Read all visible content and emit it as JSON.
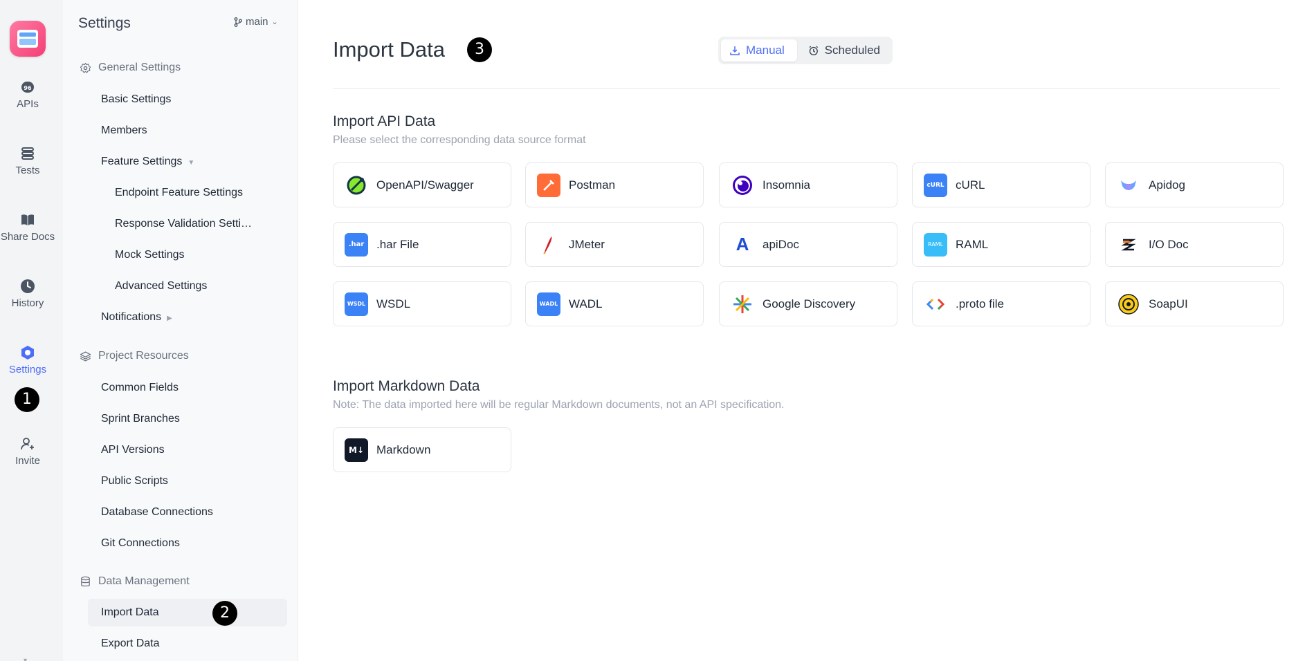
{
  "rail": {
    "items": [
      {
        "label": "APIs",
        "icon": "api-icon"
      },
      {
        "label": "Tests",
        "icon": "tests-icon"
      },
      {
        "label": "Share Docs",
        "icon": "book-icon"
      },
      {
        "label": "History",
        "icon": "clock-icon"
      },
      {
        "label": "Settings",
        "icon": "settings-icon"
      },
      {
        "label": "Invite",
        "icon": "user-plus-icon"
      }
    ],
    "active": "Settings"
  },
  "panel": {
    "title": "Settings",
    "branch": "main",
    "groups": {
      "general": "General Settings",
      "resources": "Project Resources",
      "data": "Data Management"
    },
    "items": {
      "basic": "Basic Settings",
      "members": "Members",
      "feature": "Feature Settings",
      "endpoint": "Endpoint Feature Settings",
      "response": "Response Validation Setti…",
      "mock": "Mock Settings",
      "advanced": "Advanced Settings",
      "notifications": "Notifications",
      "common_fields": "Common Fields",
      "sprint": "Sprint Branches",
      "api_versions": "API Versions",
      "public_scripts": "Public Scripts",
      "db": "Database Connections",
      "git": "Git Connections",
      "import": "Import Data",
      "export": "Export Data"
    }
  },
  "annotations": {
    "one": "1",
    "two": "2",
    "three": "3"
  },
  "main": {
    "title": "Import Data",
    "tabs": {
      "manual": "Manual",
      "scheduled": "Scheduled",
      "active": "Manual"
    },
    "api_section": {
      "title": "Import API Data",
      "subtitle": "Please select the corresponding data source format",
      "cards": [
        {
          "name": "OpenAPI/Swagger",
          "icon": "swagger-icon",
          "color": "#85ea2d"
        },
        {
          "name": "Postman",
          "icon": "postman-icon",
          "color": "#ff6c37"
        },
        {
          "name": "Insomnia",
          "icon": "insomnia-icon",
          "color": "#4000bf"
        },
        {
          "name": "cURL",
          "icon": "curl-icon",
          "color": "#3b82f6"
        },
        {
          "name": "Apidog",
          "icon": "apidog-icon",
          "color": "#8b5cf6"
        },
        {
          "name": ".har File",
          "icon": "har-icon",
          "color": "#3b82f6"
        },
        {
          "name": "JMeter",
          "icon": "jmeter-icon",
          "color": "#d22128"
        },
        {
          "name": "apiDoc",
          "icon": "apidoc-icon",
          "color": "#1d4ed8"
        },
        {
          "name": "RAML",
          "icon": "raml-icon",
          "color": "#38bdf8"
        },
        {
          "name": "I/O Doc",
          "icon": "iodoc-icon",
          "color": "#f97316"
        },
        {
          "name": "WSDL",
          "icon": "wsdl-icon",
          "color": "#3b82f6"
        },
        {
          "name": "WADL",
          "icon": "wadl-icon",
          "color": "#3b82f6"
        },
        {
          "name": "Google Discovery",
          "icon": "google-discovery-icon",
          "color": "#4285f4"
        },
        {
          "name": ".proto file",
          "icon": "proto-icon",
          "color": "#4285f4"
        },
        {
          "name": "SoapUI",
          "icon": "soapui-icon",
          "color": "#facc15"
        }
      ]
    },
    "md_section": {
      "title": "Import Markdown Data",
      "subtitle": "Note: The data imported here will be regular Markdown documents, not an API specification.",
      "cards": [
        {
          "name": "Markdown",
          "icon": "markdown-icon",
          "color": "#111827"
        }
      ]
    }
  }
}
